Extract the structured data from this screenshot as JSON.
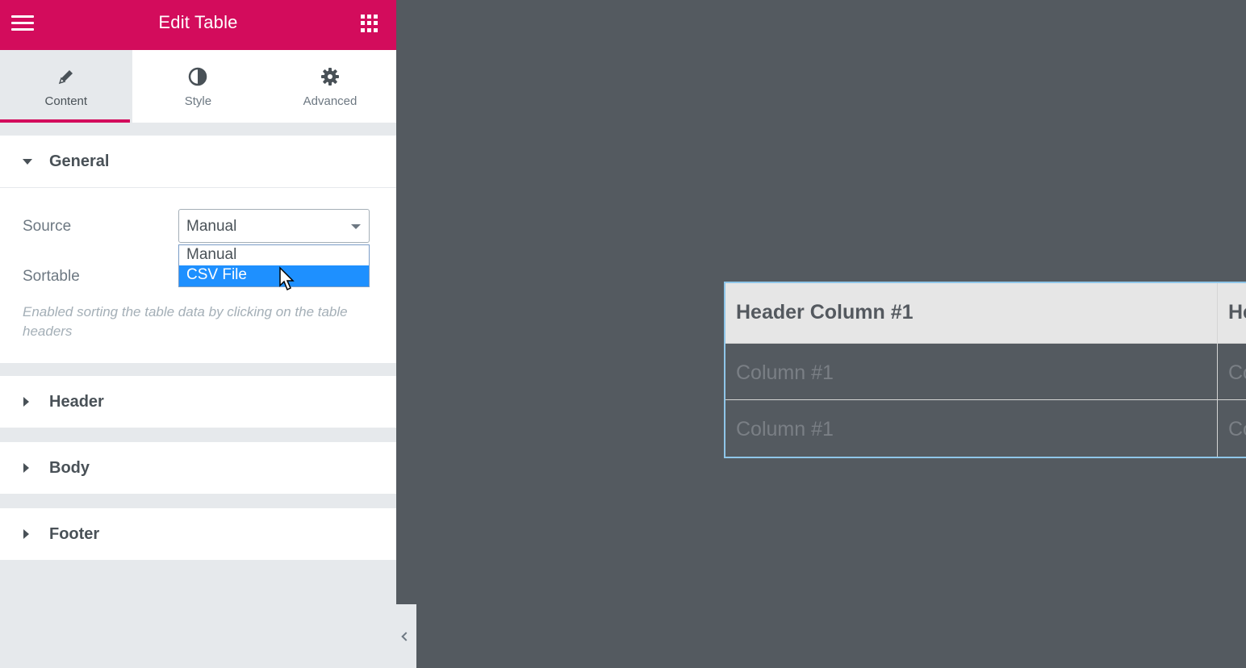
{
  "topbar": {
    "title": "Edit Table",
    "menu_icon": "hamburger-menu-icon",
    "apps_icon": "apps-grid-icon",
    "accent_color": "#d30c5c"
  },
  "tabs": [
    {
      "label": "Content",
      "icon": "pencil-icon",
      "active": true
    },
    {
      "label": "Style",
      "icon": "half-circle-icon",
      "active": false
    },
    {
      "label": "Advanced",
      "icon": "gear-icon",
      "active": false
    }
  ],
  "general": {
    "title": "General",
    "source_label": "Source",
    "source_value": "Manual",
    "sortable_label": "Sortable",
    "sortable_help": "Enabled sorting the table data by clicking on the table headers",
    "dropdown_options": [
      "Manual",
      "CSV File"
    ],
    "dropdown_highlighted": "CSV File"
  },
  "sections": {
    "header": "Header",
    "body": "Body",
    "footer": "Footer"
  },
  "preview": {
    "header": [
      "Header Column #1",
      "He"
    ],
    "rows": [
      [
        "Column #1",
        "Co"
      ],
      [
        "Column #1",
        "Co"
      ]
    ]
  }
}
